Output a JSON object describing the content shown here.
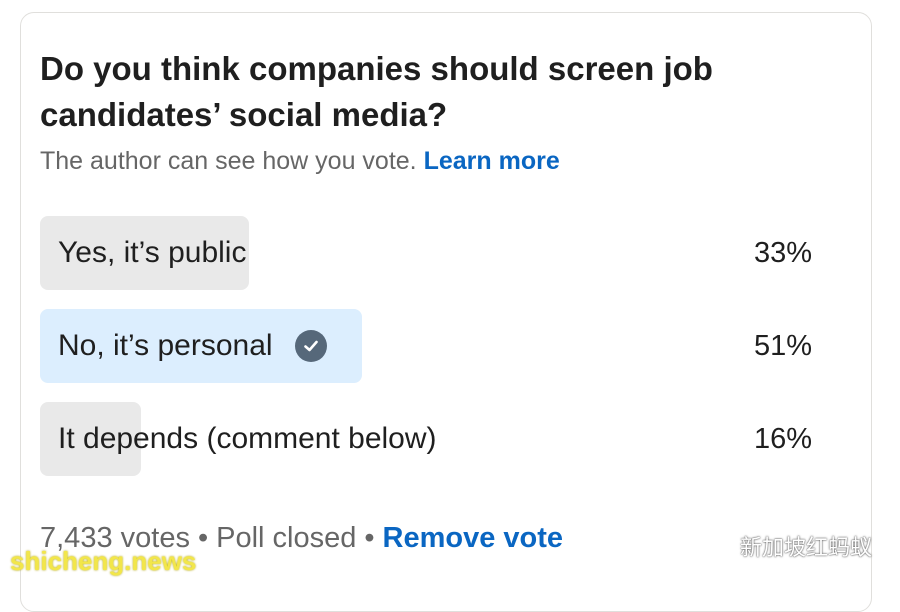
{
  "poll": {
    "question": "Do you think companies should screen job candidates’ social media?",
    "visibility_note": "The author can see how you vote.",
    "learn_more": "Learn more",
    "options": [
      {
        "label": "Yes, it’s public",
        "percent_text": "33%",
        "percent": 33,
        "selected": false
      },
      {
        "label": "No, it’s personal",
        "percent_text": "51%",
        "percent": 51,
        "selected": true
      },
      {
        "label": "It depends (comment below)",
        "percent_text": "16%",
        "percent": 16,
        "selected": false
      }
    ],
    "votes": "7,433 votes",
    "separator": "•",
    "status": "Poll closed",
    "remove_vote": "Remove vote"
  },
  "watermarks": {
    "site": "shicheng.news",
    "account": "新加坡红蚂蚁"
  },
  "icons": {
    "selected_option": "check-circle-icon",
    "wechat": "wechat-icon"
  },
  "colors": {
    "link": "#0a66c2",
    "bar_default": "#e9e9e9",
    "bar_selected": "#dceefe",
    "check": "#56687a"
  }
}
